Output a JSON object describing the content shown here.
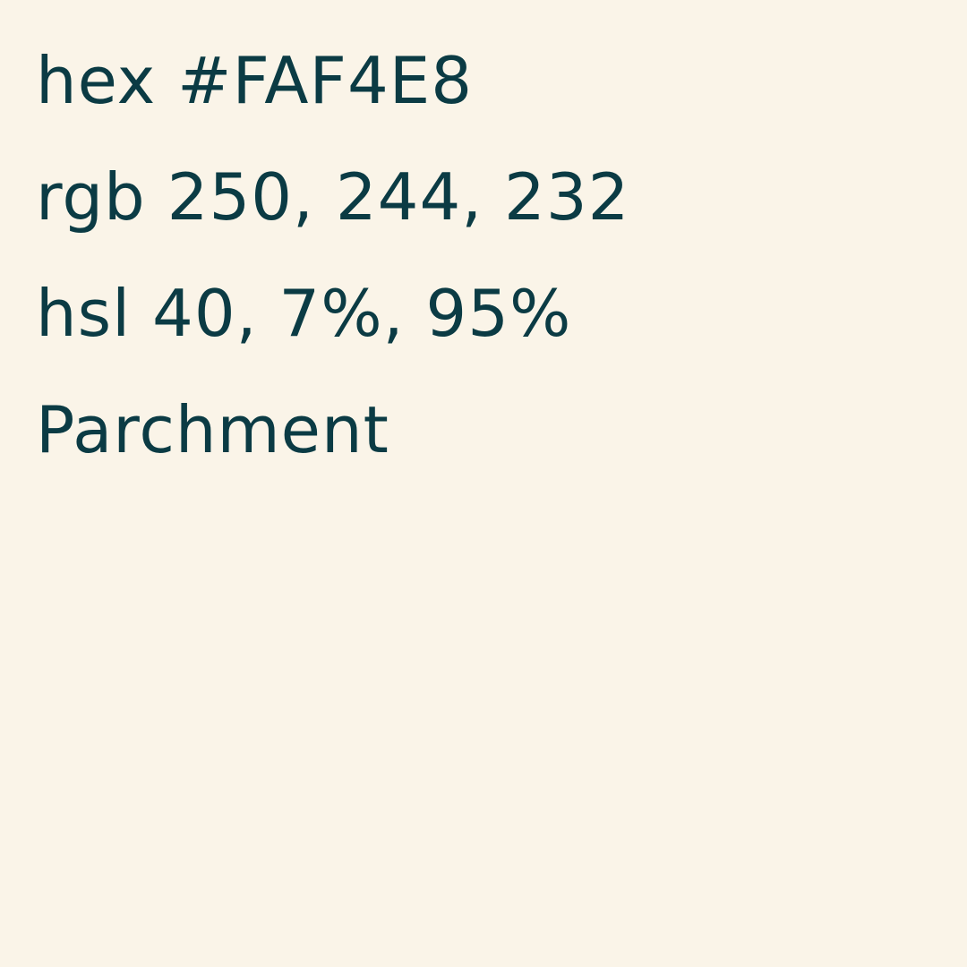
{
  "swatch": {
    "background_color": "#FAF4E8",
    "text_color": "#0B3B44",
    "hex_line": "hex #FAF4E8",
    "rgb_line": "rgb 250, 244, 232",
    "hsl_line": "hsl 40, 7%, 95%",
    "name": "Parchment"
  }
}
